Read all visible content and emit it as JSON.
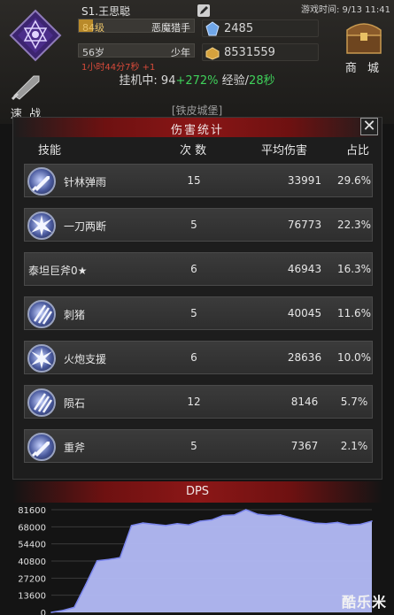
{
  "header": {
    "game_time": "游戏时间: 9/13 11:41",
    "player_name": "S1.王思聪",
    "level": "84级",
    "title": "恶魔猎手",
    "level_progress": 0.12,
    "age": "56岁",
    "stage": "少年",
    "timer": "1小时44分7秒 +1",
    "gems": "2485",
    "gold": "8531559",
    "shop_label": "商 城",
    "afk_prefix": "挂机中: 94",
    "afk_bonus": "+272%",
    "afk_exp_prefix": " 经验/",
    "afk_exp_time": "28秒",
    "fast_battle_label": "速 战",
    "castle_label": "[铁皮城堡]"
  },
  "panel": {
    "title": "伤害统计",
    "close": "✕",
    "columns": {
      "skill": "技能",
      "count": "次 数",
      "avg": "平均伤害",
      "pct": "占比"
    },
    "rows": [
      {
        "name": "针林弹雨",
        "count": "15",
        "avg": "33991",
        "pct": "29.6%",
        "icon": "sword-icon"
      },
      {
        "name": "一刀两断",
        "count": "5",
        "avg": "76773",
        "pct": "22.3%",
        "icon": "burst-icon"
      },
      {
        "name": "泰坦巨斧0★",
        "count": "6",
        "avg": "46943",
        "pct": "16.3%",
        "icon": ""
      },
      {
        "name": "刺猪",
        "count": "5",
        "avg": "40045",
        "pct": "11.6%",
        "icon": "claw-icon"
      },
      {
        "name": "火炮支援",
        "count": "6",
        "avg": "28636",
        "pct": "10.0%",
        "icon": "burst-icon"
      },
      {
        "name": "陨石",
        "count": "12",
        "avg": "8146",
        "pct": "5.7%",
        "icon": "claw-icon"
      },
      {
        "name": "重斧",
        "count": "5",
        "avg": "7367",
        "pct": "2.1%",
        "icon": "sword-icon"
      }
    ]
  },
  "watermark": "酷乐米",
  "colors": {
    "accent_red": "#8a1616",
    "bonus_green": "#3fd05a",
    "area_fill": "#b3bbf7",
    "line": "#7b86ee"
  },
  "chart_data": {
    "type": "area",
    "title": "DPS",
    "xlabel": "",
    "ylabel": "",
    "ylim": [
      0,
      81600
    ],
    "yticks": [
      0,
      13600,
      27200,
      40800,
      54400,
      68000,
      81600
    ],
    "grid": true,
    "x": [
      0,
      1,
      2,
      3,
      4,
      5,
      6,
      7,
      8,
      9,
      10,
      11,
      12,
      13,
      14,
      15,
      16,
      17,
      18,
      19,
      20,
      21,
      22,
      23,
      24,
      25,
      26,
      27,
      28
    ],
    "series": [
      {
        "values": [
          0,
          1500,
          4000,
          22000,
          41000,
          42000,
          43500,
          69000,
          71000,
          70000,
          69000,
          70500,
          69500,
          72500,
          73500,
          77000,
          77500,
          81600,
          78000,
          77000,
          77500,
          75000,
          73000,
          71000,
          70500,
          71500,
          69500,
          70000,
          72500
        ]
      }
    ]
  }
}
